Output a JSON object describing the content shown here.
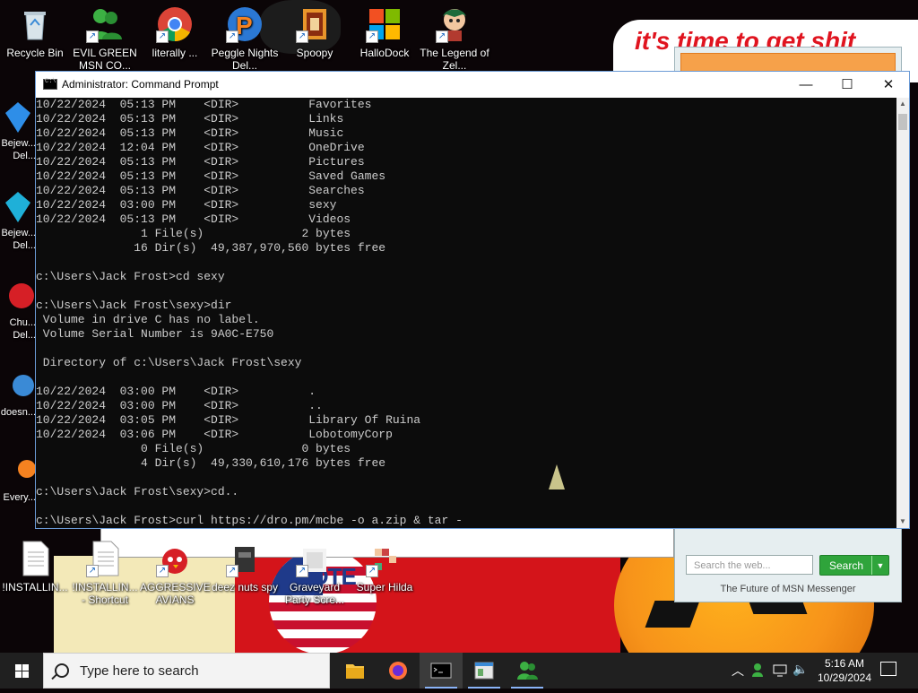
{
  "window": {
    "title": "Administrator: Command Prompt",
    "controls": {
      "minimize": "—",
      "maximize": "☐",
      "close": "✕"
    }
  },
  "console": {
    "lines": [
      "10/22/2024  05:13 PM    <DIR>          Favorites",
      "10/22/2024  05:13 PM    <DIR>          Links",
      "10/22/2024  05:13 PM    <DIR>          Music",
      "10/22/2024  12:04 PM    <DIR>          OneDrive",
      "10/22/2024  05:13 PM    <DIR>          Pictures",
      "10/22/2024  05:13 PM    <DIR>          Saved Games",
      "10/22/2024  05:13 PM    <DIR>          Searches",
      "10/22/2024  03:00 PM    <DIR>          sexy",
      "10/22/2024  05:13 PM    <DIR>          Videos",
      "               1 File(s)              2 bytes",
      "              16 Dir(s)  49,387,970,560 bytes free",
      "",
      "c:\\Users\\Jack Frost>cd sexy",
      "",
      "c:\\Users\\Jack Frost\\sexy>dir",
      " Volume in drive C has no label.",
      " Volume Serial Number is 9A0C-E750",
      "",
      " Directory of c:\\Users\\Jack Frost\\sexy",
      "",
      "10/22/2024  03:00 PM    <DIR>          .",
      "10/22/2024  03:00 PM    <DIR>          ..",
      "10/22/2024  03:05 PM    <DIR>          Library Of Ruina",
      "10/22/2024  03:06 PM    <DIR>          LobotomyCorp",
      "               0 File(s)              0 bytes",
      "               4 Dir(s)  49,330,610,176 bytes free",
      "",
      "c:\\Users\\Jack Frost\\sexy>cd..",
      "",
      "c:\\Users\\Jack Frost>curl https://dro.pm/mcbe -o a.zip & tar -"
    ]
  },
  "desktop": {
    "top_icons": [
      {
        "label": "Recycle Bin",
        "icon": "recycle-bin-icon",
        "shortcut": false
      },
      {
        "label": "EVIL GREEN MSN CO...",
        "icon": "msn-buddy-icon",
        "shortcut": true
      },
      {
        "label": "literally ...",
        "icon": "chrome-icon",
        "shortcut": true
      },
      {
        "label": "Peggle Nights Del...",
        "icon": "peggle-icon",
        "shortcut": true
      },
      {
        "label": "Spoopy",
        "icon": "spoopy-icon",
        "shortcut": true
      },
      {
        "label": "HalloDock",
        "icon": "windows-logo-icon",
        "shortcut": true
      },
      {
        "label": "The Legend of Zel...",
        "icon": "game-character-icon",
        "shortcut": true
      }
    ],
    "left_icons": [
      {
        "label": "Bejew... Del...",
        "icon": "bejeweled-icon"
      },
      {
        "label": "Bejew... Del...",
        "icon": "bejeweled-icon"
      },
      {
        "label": "Chu... Del...",
        "icon": "chuzzle-icon"
      },
      {
        "label": "doesn...",
        "icon": "app-icon"
      },
      {
        "label": "Every...",
        "icon": "app-icon"
      }
    ],
    "bottom_icons": [
      {
        "label": "!INSTALLIN...",
        "icon": "document-icon",
        "shortcut": false
      },
      {
        "label": "!INSTALLIN... - Shortcut",
        "icon": "document-icon",
        "shortcut": true
      },
      {
        "label": "AGGRESSIVE AVIANS",
        "icon": "angry-bird-icon",
        "shortcut": true
      },
      {
        "label": "deez nuts spy",
        "icon": "spy-icon",
        "shortcut": true
      },
      {
        "label": "Graveyard Party Scre...",
        "icon": "graveyard-icon",
        "shortcut": true
      },
      {
        "label": "Super Hilda",
        "icon": "pixel-game-icon",
        "shortcut": true
      }
    ],
    "banner_text": "it's time to get shit",
    "vote_text": "VOTE"
  },
  "msn_widget": {
    "search_placeholder": "Search the web...",
    "search_button": "Search",
    "footer": "The Future of MSN Messenger"
  },
  "taskbar": {
    "search_placeholder": "Type here to search",
    "apps": [
      "file-explorer-icon",
      "firefox-icon",
      "command-prompt-icon",
      "window-app-icon",
      "msn-buddy-icon"
    ],
    "time": "5:16 AM",
    "date": "10/29/2024"
  },
  "colors": {
    "console_bg": "#0c0c0c",
    "console_text": "#cccccc",
    "taskbar_bg": "#202020",
    "msn_green": "#2fa43b"
  }
}
